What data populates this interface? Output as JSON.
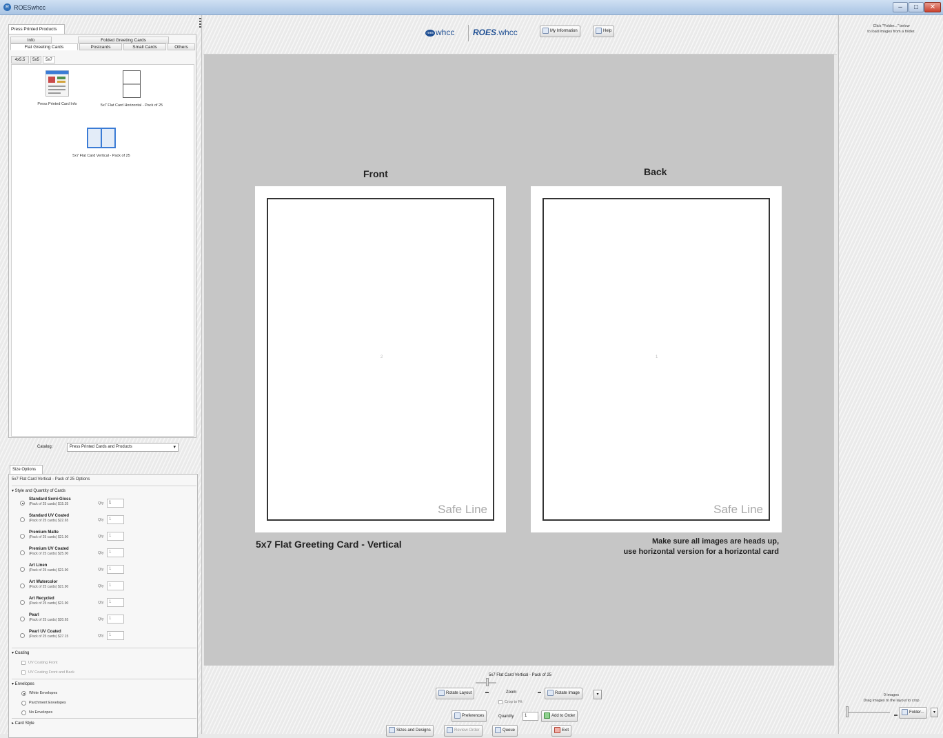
{
  "window": {
    "title": "ROESwhcc",
    "controls": [
      "–",
      "□",
      "✕"
    ]
  },
  "left": {
    "top_tab": "Press Printed Products",
    "category_tabs_row1": [
      {
        "label": "Info"
      },
      {
        "label": "Folded Greeting Cards"
      }
    ],
    "category_tabs_row2": [
      {
        "label": "Flat Greeting Cards"
      },
      {
        "label": "Postcards"
      },
      {
        "label": "Small Cards"
      },
      {
        "label": "Others"
      }
    ],
    "size_tabs": [
      "4x5.5",
      "5x5",
      "5x7"
    ],
    "products": [
      {
        "label": "Press Printed Card Info"
      },
      {
        "label": "5x7 Flat Card Horizontal - Pack of 25"
      },
      {
        "label": "5x7 Flat Card Vertical - Pack of 25"
      }
    ],
    "catalog_label": "Catalog:",
    "catalog_value": "Press Printed Cards and Products",
    "options_tab": "Size Options",
    "options_title": "5x7 Flat Card Vertical - Pack of 25 Options",
    "style_section": "▾ Style and Quantity of Cards",
    "qty_label": "Qty",
    "papers": [
      {
        "name": "Standard Semi-Gloss",
        "price": "(Pack of 25 cards) $15.35",
        "qty": "1",
        "selected": true
      },
      {
        "name": "Standard UV Coated",
        "price": "(Pack of 25 cards) $22.65",
        "qty": "1",
        "selected": false
      },
      {
        "name": "Premium Matte",
        "price": "(Pack of 25 cards) $21.90",
        "qty": "1",
        "selected": false
      },
      {
        "name": "Premium UV Coated",
        "price": "(Pack of 25 cards) $25.00",
        "qty": "1",
        "selected": false
      },
      {
        "name": "Art Linen",
        "price": "(Pack of 25 cards) $21.90",
        "qty": "1",
        "selected": false
      },
      {
        "name": "Art Watercolor",
        "price": "(Pack of 25 cards) $21.90",
        "qty": "1",
        "selected": false
      },
      {
        "name": "Art Recycled",
        "price": "(Pack of 25 cards) $21.90",
        "qty": "1",
        "selected": false
      },
      {
        "name": "Pearl",
        "price": "(Pack of 25 cards) $20.65",
        "qty": "1",
        "selected": false
      },
      {
        "name": "Pearl UV Coated",
        "price": "(Pack of 25 cards) $27.15",
        "qty": "1",
        "selected": false
      }
    ],
    "coating_section": "▾ Coating",
    "coating_options": [
      "UV Coating Front",
      "UV Coating Front and Back"
    ],
    "envelopes_section": "▾ Envelopes",
    "envelope_options": [
      "White Envelopes",
      "Parchment Envelopes",
      "No Envelopes"
    ],
    "envelope_selected": 0,
    "card_style_section": "▸ Card Style"
  },
  "toolbar": {
    "logo_whcc": "whcc",
    "logo_badge": "roes",
    "logo_roes_bold": "ROES",
    "logo_roes_rest": ".whcc",
    "my_information": "My Information",
    "help": "Help"
  },
  "canvas": {
    "front_label": "Front",
    "back_label": "Back",
    "safe_line": "Safe Line",
    "front_page_num": "2",
    "back_page_num": "1",
    "caption": "5x7 Flat Greeting Card - Vertical",
    "warning_line1": "Make sure all images are heads up,",
    "warning_line2": "use horizontal version for a horizontal card"
  },
  "bottom": {
    "template_name": "5x7 Flat Card Vertical - Pack of 25",
    "rotate_layout": "Rotate Layout",
    "zoom_label": "Zoom",
    "crop_to_fit": "Crop to Fit",
    "rotate_image": "Rotate Image",
    "preferences": "Preferences",
    "quantity_label": "Quantity",
    "quantity_value": "1",
    "add_to_order": "Add to Order",
    "tabs": [
      "Sizes and Designs",
      "Review Order",
      "Queue",
      "Exit"
    ]
  },
  "right": {
    "hint_line1": "Click \"Folder...\" below",
    "hint_line2": "to load images from a folder.",
    "count_line1": "0 images",
    "count_line2": "Drag images to the layout to crop",
    "folder_button": "Folder..."
  }
}
